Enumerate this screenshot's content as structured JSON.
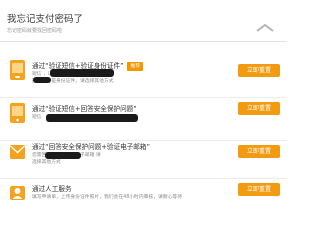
{
  "header": {
    "title": "我忘记支付密码了",
    "subtitle": "忘记密码就要找回密码啦"
  },
  "options": [
    {
      "title": "通过“验证短信+验证身份证件”",
      "badge": "推荐",
      "desc_l1": "短信               ，以确保是",
      "desc_l2": "操作；若是身份证件，请选择其他方式",
      "button": "立即重置"
    },
    {
      "title": "通过“验证短信+回答安全保护问题”",
      "desc_l1": "短信",
      "desc_l2": "",
      "button": "立即重置"
    },
    {
      "title": "通过“回答安全保护问题+验证电子邮箱”",
      "desc_l1": "您需回答问题，验证电子邮箱             请",
      "desc_l2": "选择其他方式",
      "button": "立即重置"
    },
    {
      "title": "通过人工服务",
      "desc_l1": "填写申请单，上传身份证件照片，我们会在48小时内审核，请耐心等待",
      "desc_l2": "",
      "button": "立即重置"
    }
  ],
  "colors": {
    "accent": "#f29b10",
    "badge": "#f39800",
    "icon": "#f7a21b"
  }
}
